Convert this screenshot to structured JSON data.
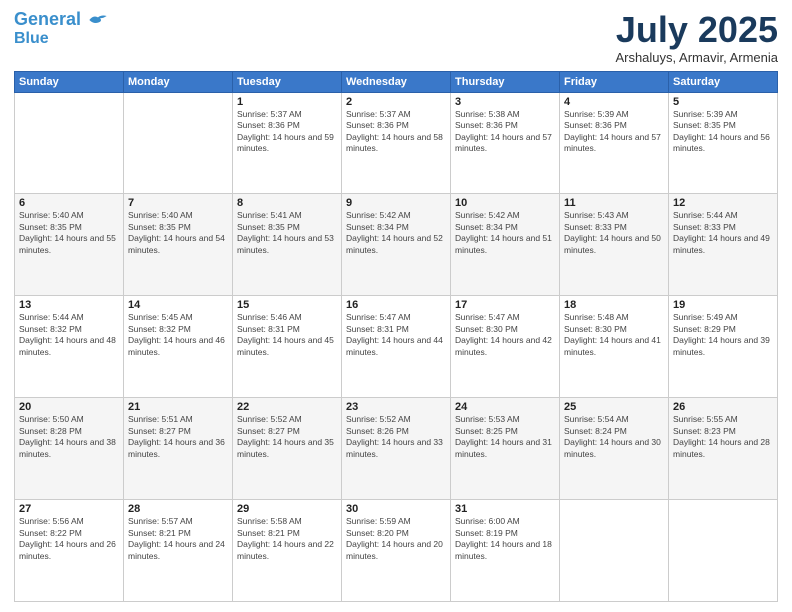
{
  "header": {
    "logo_line1": "General",
    "logo_line2": "Blue",
    "month_title": "July 2025",
    "subtitle": "Arshaluys, Armavir, Armenia"
  },
  "days_of_week": [
    "Sunday",
    "Monday",
    "Tuesday",
    "Wednesday",
    "Thursday",
    "Friday",
    "Saturday"
  ],
  "weeks": [
    [
      {
        "day": "",
        "info": ""
      },
      {
        "day": "",
        "info": ""
      },
      {
        "day": "1",
        "info": "Sunrise: 5:37 AM\nSunset: 8:36 PM\nDaylight: 14 hours and 59 minutes."
      },
      {
        "day": "2",
        "info": "Sunrise: 5:37 AM\nSunset: 8:36 PM\nDaylight: 14 hours and 58 minutes."
      },
      {
        "day": "3",
        "info": "Sunrise: 5:38 AM\nSunset: 8:36 PM\nDaylight: 14 hours and 57 minutes."
      },
      {
        "day": "4",
        "info": "Sunrise: 5:39 AM\nSunset: 8:36 PM\nDaylight: 14 hours and 57 minutes."
      },
      {
        "day": "5",
        "info": "Sunrise: 5:39 AM\nSunset: 8:35 PM\nDaylight: 14 hours and 56 minutes."
      }
    ],
    [
      {
        "day": "6",
        "info": "Sunrise: 5:40 AM\nSunset: 8:35 PM\nDaylight: 14 hours and 55 minutes."
      },
      {
        "day": "7",
        "info": "Sunrise: 5:40 AM\nSunset: 8:35 PM\nDaylight: 14 hours and 54 minutes."
      },
      {
        "day": "8",
        "info": "Sunrise: 5:41 AM\nSunset: 8:35 PM\nDaylight: 14 hours and 53 minutes."
      },
      {
        "day": "9",
        "info": "Sunrise: 5:42 AM\nSunset: 8:34 PM\nDaylight: 14 hours and 52 minutes."
      },
      {
        "day": "10",
        "info": "Sunrise: 5:42 AM\nSunset: 8:34 PM\nDaylight: 14 hours and 51 minutes."
      },
      {
        "day": "11",
        "info": "Sunrise: 5:43 AM\nSunset: 8:33 PM\nDaylight: 14 hours and 50 minutes."
      },
      {
        "day": "12",
        "info": "Sunrise: 5:44 AM\nSunset: 8:33 PM\nDaylight: 14 hours and 49 minutes."
      }
    ],
    [
      {
        "day": "13",
        "info": "Sunrise: 5:44 AM\nSunset: 8:32 PM\nDaylight: 14 hours and 48 minutes."
      },
      {
        "day": "14",
        "info": "Sunrise: 5:45 AM\nSunset: 8:32 PM\nDaylight: 14 hours and 46 minutes."
      },
      {
        "day": "15",
        "info": "Sunrise: 5:46 AM\nSunset: 8:31 PM\nDaylight: 14 hours and 45 minutes."
      },
      {
        "day": "16",
        "info": "Sunrise: 5:47 AM\nSunset: 8:31 PM\nDaylight: 14 hours and 44 minutes."
      },
      {
        "day": "17",
        "info": "Sunrise: 5:47 AM\nSunset: 8:30 PM\nDaylight: 14 hours and 42 minutes."
      },
      {
        "day": "18",
        "info": "Sunrise: 5:48 AM\nSunset: 8:30 PM\nDaylight: 14 hours and 41 minutes."
      },
      {
        "day": "19",
        "info": "Sunrise: 5:49 AM\nSunset: 8:29 PM\nDaylight: 14 hours and 39 minutes."
      }
    ],
    [
      {
        "day": "20",
        "info": "Sunrise: 5:50 AM\nSunset: 8:28 PM\nDaylight: 14 hours and 38 minutes."
      },
      {
        "day": "21",
        "info": "Sunrise: 5:51 AM\nSunset: 8:27 PM\nDaylight: 14 hours and 36 minutes."
      },
      {
        "day": "22",
        "info": "Sunrise: 5:52 AM\nSunset: 8:27 PM\nDaylight: 14 hours and 35 minutes."
      },
      {
        "day": "23",
        "info": "Sunrise: 5:52 AM\nSunset: 8:26 PM\nDaylight: 14 hours and 33 minutes."
      },
      {
        "day": "24",
        "info": "Sunrise: 5:53 AM\nSunset: 8:25 PM\nDaylight: 14 hours and 31 minutes."
      },
      {
        "day": "25",
        "info": "Sunrise: 5:54 AM\nSunset: 8:24 PM\nDaylight: 14 hours and 30 minutes."
      },
      {
        "day": "26",
        "info": "Sunrise: 5:55 AM\nSunset: 8:23 PM\nDaylight: 14 hours and 28 minutes."
      }
    ],
    [
      {
        "day": "27",
        "info": "Sunrise: 5:56 AM\nSunset: 8:22 PM\nDaylight: 14 hours and 26 minutes."
      },
      {
        "day": "28",
        "info": "Sunrise: 5:57 AM\nSunset: 8:21 PM\nDaylight: 14 hours and 24 minutes."
      },
      {
        "day": "29",
        "info": "Sunrise: 5:58 AM\nSunset: 8:21 PM\nDaylight: 14 hours and 22 minutes."
      },
      {
        "day": "30",
        "info": "Sunrise: 5:59 AM\nSunset: 8:20 PM\nDaylight: 14 hours and 20 minutes."
      },
      {
        "day": "31",
        "info": "Sunrise: 6:00 AM\nSunset: 8:19 PM\nDaylight: 14 hours and 18 minutes."
      },
      {
        "day": "",
        "info": ""
      },
      {
        "day": "",
        "info": ""
      }
    ]
  ]
}
